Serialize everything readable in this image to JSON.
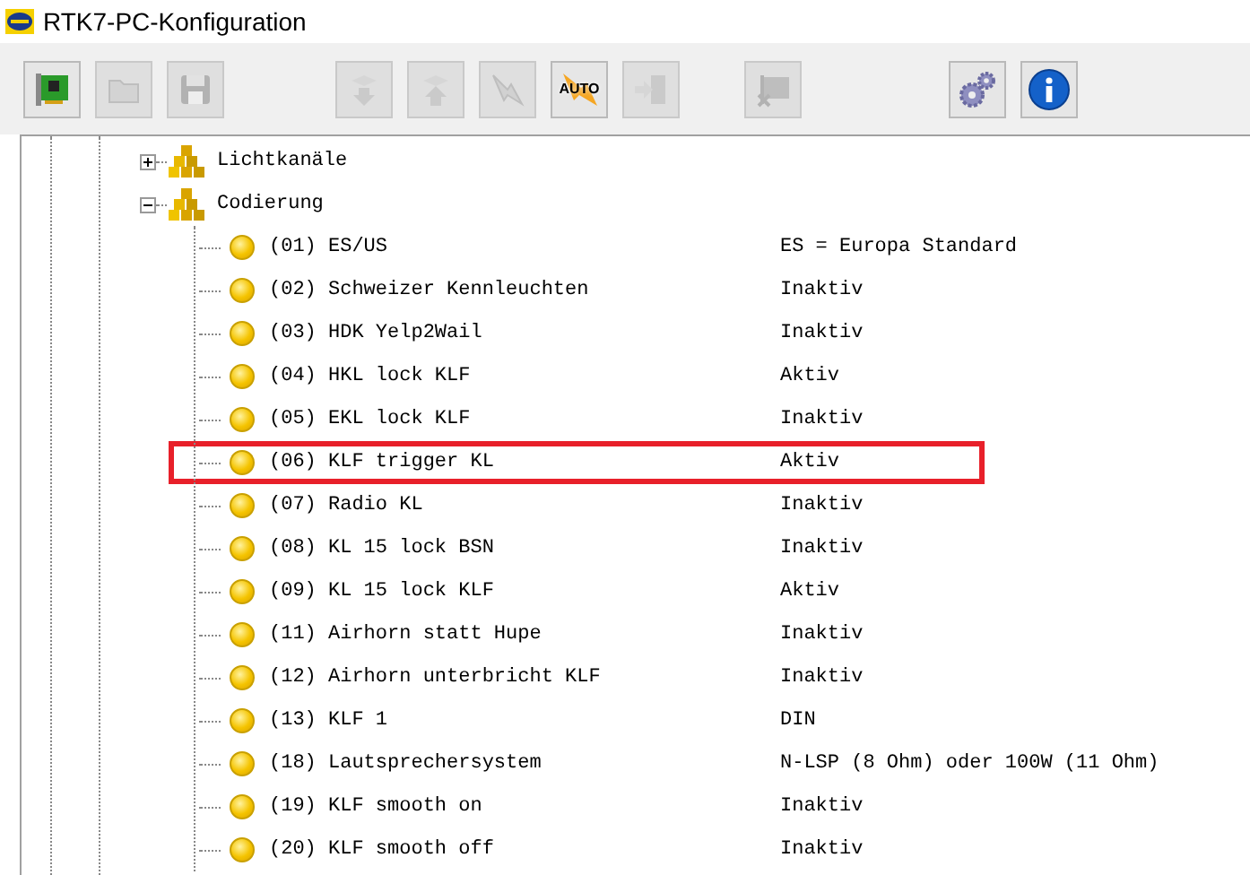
{
  "window": {
    "title": "RTK7-PC-Konfiguration"
  },
  "toolbar": [
    {
      "kind": "card",
      "disabled": false
    },
    {
      "kind": "folder",
      "disabled": true
    },
    {
      "kind": "save",
      "disabled": true
    },
    {
      "kind": "gap"
    },
    {
      "kind": "download",
      "disabled": true
    },
    {
      "kind": "upload",
      "disabled": true
    },
    {
      "kind": "flash",
      "disabled": true
    },
    {
      "kind": "auto",
      "label": "AUTO",
      "disabled": false
    },
    {
      "kind": "exit",
      "disabled": true
    },
    {
      "kind": "gap"
    },
    {
      "kind": "card-x",
      "disabled": true
    },
    {
      "kind": "gap"
    },
    {
      "kind": "gears",
      "disabled": false
    },
    {
      "kind": "info",
      "disabled": false
    }
  ],
  "tree": [
    {
      "label": "Lichtkanäle",
      "expanded": false
    },
    {
      "label": "Codierung",
      "expanded": true,
      "children": [
        {
          "label": "(01) ES/US",
          "value": "ES = Europa Standard",
          "highlighted": false
        },
        {
          "label": "(02) Schweizer Kennleuchten",
          "value": "Inaktiv",
          "highlighted": false
        },
        {
          "label": "(03) HDK Yelp2Wail",
          "value": "Inaktiv",
          "highlighted": false
        },
        {
          "label": "(04) HKL lock KLF",
          "value": "Aktiv",
          "highlighted": false
        },
        {
          "label": "(05) EKL lock KLF",
          "value": "Inaktiv",
          "highlighted": false
        },
        {
          "label": "(06) KLF trigger KL",
          "value": "Aktiv",
          "highlighted": true
        },
        {
          "label": "(07) Radio KL",
          "value": "Inaktiv",
          "highlighted": false
        },
        {
          "label": "(08) KL 15 lock BSN",
          "value": "Inaktiv",
          "highlighted": false
        },
        {
          "label": "(09) KL 15 lock KLF",
          "value": "Aktiv",
          "highlighted": false
        },
        {
          "label": "(11) Airhorn statt Hupe",
          "value": "Inaktiv",
          "highlighted": false
        },
        {
          "label": "(12) Airhorn unterbricht KLF",
          "value": "Inaktiv",
          "highlighted": false
        },
        {
          "label": "(13) KLF 1",
          "value": "DIN",
          "highlighted": false
        },
        {
          "label": "(18) Lautsprechersystem",
          "value": "N-LSP (8 Ohm) oder 100W (11 Ohm)",
          "highlighted": false
        },
        {
          "label": "(19) KLF smooth on",
          "value": "Inaktiv",
          "highlighted": false
        },
        {
          "label": "(20) KLF smooth off",
          "value": "Inaktiv",
          "highlighted": false
        }
      ]
    }
  ]
}
